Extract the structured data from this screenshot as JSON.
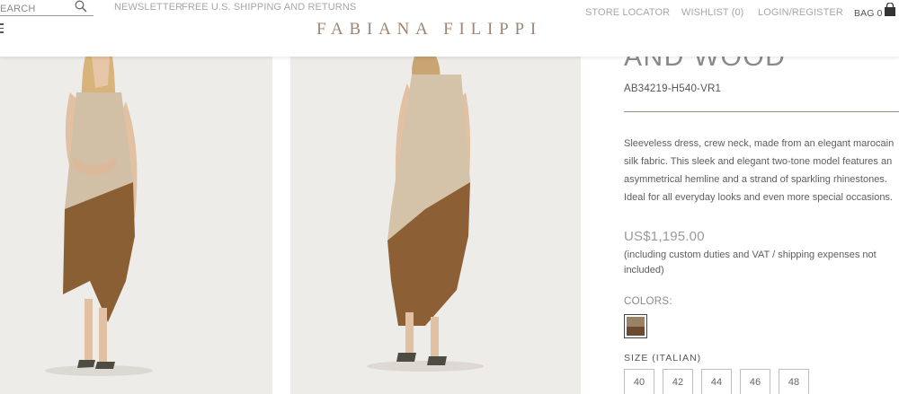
{
  "header": {
    "search_placeholder": "EARCH",
    "newsletter": "NEWSLETTER",
    "shipping": "FREE U.S. SHIPPING AND RETURNS",
    "logo": "FABIANA FILIPPI",
    "store_locator": "STORE LOCATOR",
    "wishlist": "WISHLIST (0)",
    "login": "LOGIN/REGISTER",
    "bag": "BAG 0"
  },
  "product": {
    "title_fragment": "AND WOOD",
    "sku": "AB34219-H540-VR1",
    "description": "Sleeveless dress, crew neck, made from an elegant marocain silk fabric. This sleek and elegant two-tone model features an asymmetrical hemline and a strand of sparkling rhinestones. Ideal for all everyday looks and even more special occasions.",
    "price": "US$1,195.00",
    "price_note": "(including custom duties and VAT / shipping expenses not included)",
    "colors_label": "COLORS:",
    "swatch_colors": [
      "#9a8266",
      "#6c4a2f"
    ],
    "size_label": "SIZE (ITALIAN)",
    "sizes": [
      "40",
      "42",
      "44",
      "46",
      "48"
    ]
  },
  "icons": [
    "search-icon",
    "menu-icon",
    "shopping-bag-icon"
  ]
}
